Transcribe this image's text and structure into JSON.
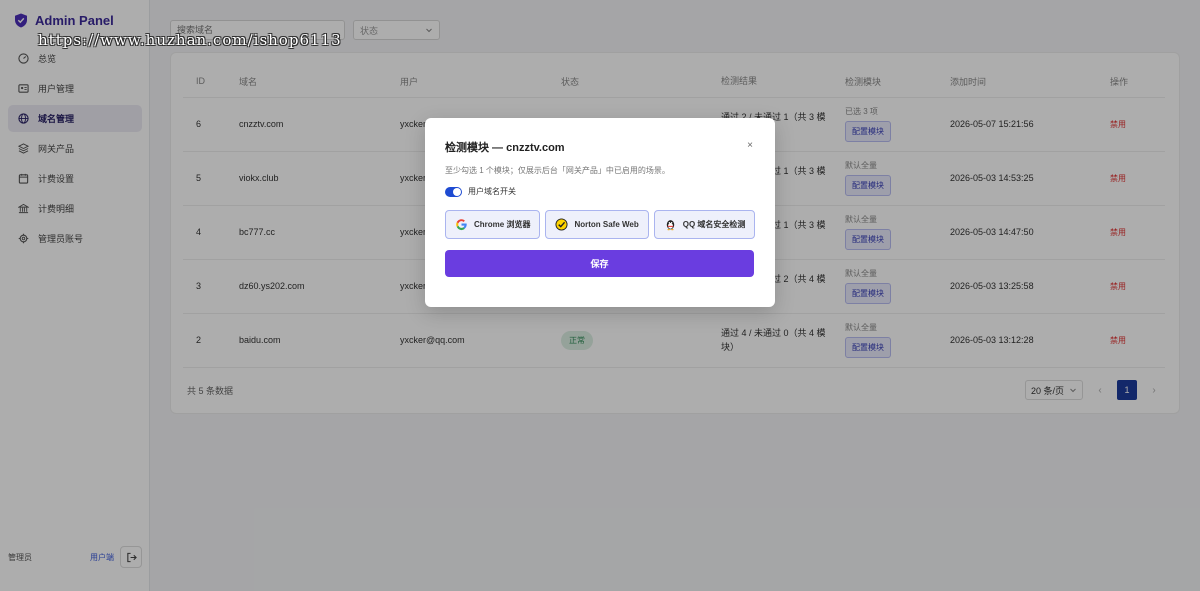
{
  "brand": {
    "title": "Admin Panel"
  },
  "watermark": "https://www.huzhan.com/ishop6113",
  "nav": [
    {
      "label": "总览",
      "icon": "dashboard-icon"
    },
    {
      "label": "用户管理",
      "icon": "user-card-icon"
    },
    {
      "label": "域名管理",
      "icon": "globe-icon",
      "active": true
    },
    {
      "label": "网关产品",
      "icon": "layers-icon"
    },
    {
      "label": "计费设置",
      "icon": "calendar-icon"
    },
    {
      "label": "计费明细",
      "icon": "bank-icon"
    },
    {
      "label": "管理员账号",
      "icon": "gear-icon"
    }
  ],
  "sidebar_footer": {
    "role": "管理员",
    "user_link": "用户端"
  },
  "filters": {
    "search_placeholder": "搜索域名",
    "status_placeholder": "状态"
  },
  "table": {
    "headers": [
      "ID",
      "域名",
      "用户",
      "状态",
      "检测结果",
      "检测模块",
      "添加时间",
      "操作"
    ],
    "rows": [
      {
        "id": "6",
        "domain": "cnzztv.com",
        "user": "yxcker",
        "status": "",
        "result": "通过 2 / 未通过 1（共 3 模块）",
        "module_summary": "已选 3 项",
        "config": "配置模块",
        "time": "2026-05-07 15:21:56",
        "op": "禁用"
      },
      {
        "id": "5",
        "domain": "viokx.club",
        "user": "yxcker",
        "status": "",
        "result": "通过 2 / 未通过 1（共 3 模块）",
        "module_summary": "默认全量",
        "config": "配置模块",
        "time": "2026-05-03 14:53:25",
        "op": "禁用"
      },
      {
        "id": "4",
        "domain": "bc777.cc",
        "user": "yxcker",
        "status": "",
        "result": "通过 2 / 未通过 1（共 3 模块）",
        "module_summary": "默认全量",
        "config": "配置模块",
        "time": "2026-05-03 14:47:50",
        "op": "禁用"
      },
      {
        "id": "3",
        "domain": "dz60.ys202.com",
        "user": "yxcker",
        "status": "",
        "result": "通过 2 / 未通过 2（共 4 模块）",
        "module_summary": "默认全量",
        "config": "配置模块",
        "time": "2026-05-03 13:25:58",
        "op": "禁用"
      },
      {
        "id": "2",
        "domain": "baidu.com",
        "user": "yxcker@qq.com",
        "status": "正常",
        "result": "通过 4 / 未通过 0（共 4 模块）",
        "module_summary": "默认全量",
        "config": "配置模块",
        "time": "2026-05-03 13:12:28",
        "op": "禁用"
      }
    ]
  },
  "pagination": {
    "total": "共 5 条数据",
    "page_size": "20 条/页",
    "current_page": "1"
  },
  "modal": {
    "title": "检测模块 — cnzztv.com",
    "close": "×",
    "hint": "至少勾选 1 个模块；仅展示后台「网关产品」中已启用的场景。",
    "toggle_label": "用户域名开关",
    "modules": [
      {
        "label": "Chrome 浏览器",
        "icon": "google-icon"
      },
      {
        "label": "Norton Safe Web",
        "icon": "norton-check-icon"
      },
      {
        "label": "QQ 域名安全检测",
        "icon": "qq-penguin-icon"
      }
    ],
    "save_label": "保存"
  }
}
